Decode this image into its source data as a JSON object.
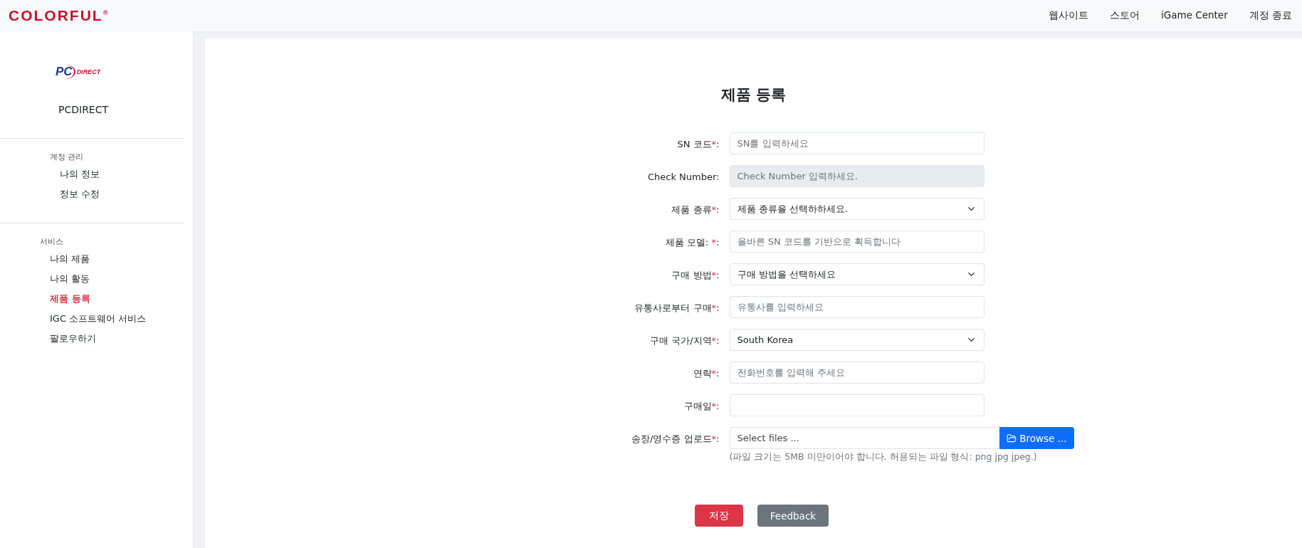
{
  "header": {
    "logo": "COLORFUL$^{®}$",
    "links": [
      "웹사이트",
      "스토어",
      "iGame Center",
      "계정 종료"
    ]
  },
  "sidebar": {
    "logo": {
      "mark": "PC",
      "word": "DIRECT"
    },
    "name": "PCDIRECT",
    "groups": [
      {
        "title": "계정 관리",
        "indent": true,
        "items": [
          {
            "label": "나의 정보",
            "selected": false
          },
          {
            "label": "정보 수정",
            "selected": false
          }
        ]
      },
      {
        "title": "서비스",
        "indent": false,
        "items": [
          {
            "label": "나의 제품",
            "selected": false
          },
          {
            "label": "나의 활동",
            "selected": false
          },
          {
            "label": "제품 등록",
            "selected": true
          },
          {
            "label": "IGC 소프트웨어 서비스",
            "selected": false
          },
          {
            "label": "팔로우하기",
            "selected": false
          }
        ]
      }
    ]
  },
  "form": {
    "title": "제품 등록",
    "fields": [
      {
        "kind": "input",
        "label": "SN 코드",
        "asterisk": "*",
        "colon": ":",
        "placeholder": "SN를 입력하세요",
        "disabled": false
      },
      {
        "kind": "input",
        "label": "Check Number",
        "colon": ":",
        "placeholder": "Check Number 입력하세요.",
        "disabled": true
      },
      {
        "kind": "select",
        "label": "제품 종류",
        "asterisk": "*",
        "colon": ":",
        "value": "제품 종류을 선택하하세요."
      },
      {
        "kind": "input",
        "label": "제품 모델: ",
        "asterisk": "*",
        "colon": ":",
        "placeholder": "올바른 SN 코드를 기반으로 획득합니다",
        "disabled": false
      },
      {
        "kind": "select",
        "label": "구매 방법",
        "asterisk": "*",
        "colon": ":",
        "value": "구매 방법을 선택하세요"
      },
      {
        "kind": "input",
        "label": "유통사로부터 구매",
        "asterisk": "*",
        "colon": ":",
        "placeholder": "유통사를 입력하세요",
        "disabled": false
      },
      {
        "kind": "select",
        "label": "구매 국가/지역",
        "asterisk": "*",
        "colon": ":",
        "value": "South Korea"
      },
      {
        "kind": "input",
        "label": "연락",
        "asterisk": "*",
        "colon": ":",
        "placeholder": "전화번호를 입력해 주세요",
        "disabled": false
      },
      {
        "kind": "input",
        "label": "구매일",
        "asterisk": "*",
        "colon": ":",
        "disabled": false
      },
      {
        "kind": "file",
        "label": "송장/영수증 업로드",
        "asterisk": "*",
        "colon": ":",
        "placeholder": "Select files ...",
        "button": "Browse ...",
        "hint": "(파일 크기는 5MB 미만이어야 합니다. 허용되는 파일 형식: png jpg jpeg.)"
      }
    ],
    "buttons": [
      {
        "label": "저장",
        "kind": "primary"
      },
      {
        "label": "Feedback",
        "kind": "secondary"
      }
    ]
  }
}
